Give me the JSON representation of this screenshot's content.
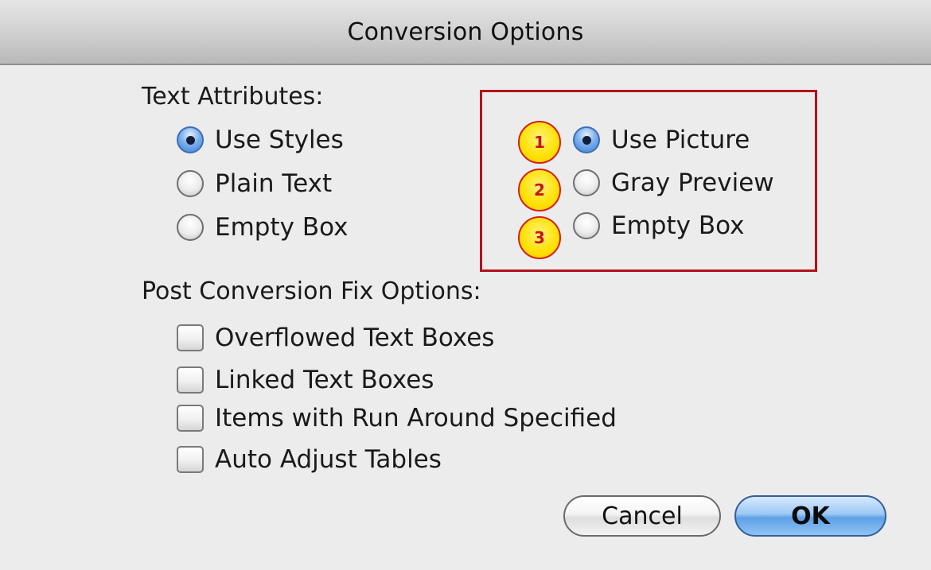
{
  "window": {
    "title": "Conversion Options"
  },
  "text_attributes": {
    "heading": "Text Attributes:",
    "options": [
      {
        "label": "Use Styles",
        "checked": true
      },
      {
        "label": "Plain Text",
        "checked": false
      },
      {
        "label": "Empty Box",
        "checked": false
      }
    ]
  },
  "picture_options": {
    "options": [
      {
        "label": "Use Picture",
        "checked": true,
        "badge": "1"
      },
      {
        "label": "Gray Preview",
        "checked": false,
        "badge": "2"
      },
      {
        "label": "Empty Box",
        "checked": false,
        "badge": "3"
      }
    ],
    "highlight_color": "#b3121c"
  },
  "post_conversion": {
    "heading": "Post Conversion Fix Options:",
    "options": [
      {
        "label": "Overflowed Text Boxes",
        "checked": false
      },
      {
        "label": "Linked Text Boxes",
        "checked": false
      },
      {
        "label": "Items with Run Around Specified",
        "checked": false
      },
      {
        "label": "Auto Adjust Tables",
        "checked": false
      }
    ]
  },
  "buttons": {
    "cancel_label": "Cancel",
    "ok_label": "OK"
  },
  "colors": {
    "accent": "#3a7fd6",
    "badge_fill": "#ffe100",
    "badge_text": "#c81414"
  }
}
